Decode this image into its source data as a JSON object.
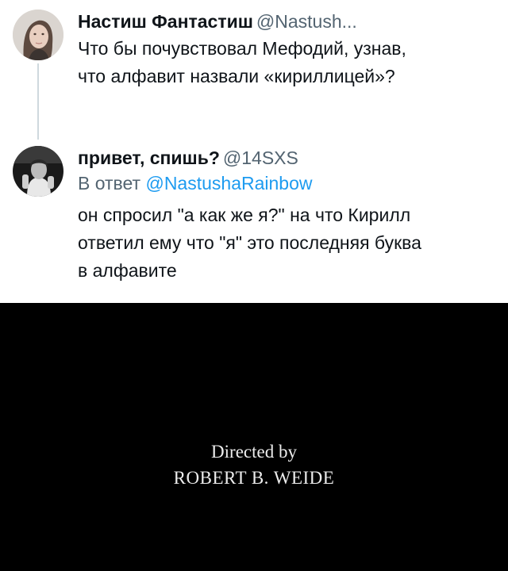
{
  "tweets": [
    {
      "author_name": "Настиш Фантастиш",
      "handle": "@Nastush...",
      "text_lines": [
        "Что бы почувствовал Мефодий, узнав,",
        "что алфавит назвали «кириллицей»?"
      ]
    },
    {
      "author_name": "привет, спишь?",
      "handle": "@14SXS",
      "reply_prefix": "В ответ",
      "reply_handle": "@NastushaRainbow",
      "text_lines": [
        "он спросил \"а как же я?\" на что Кирилл",
        "ответил ему что \"я\" это последняя буква",
        "в алфавите"
      ]
    }
  ],
  "credits": {
    "line1": "Directed by",
    "line2": "ROBERT B. WEIDE"
  },
  "colors": {
    "handle_gray": "#536471",
    "link_blue": "#1d9bf0",
    "text": "#0f1419",
    "credits_bg": "#000000"
  }
}
